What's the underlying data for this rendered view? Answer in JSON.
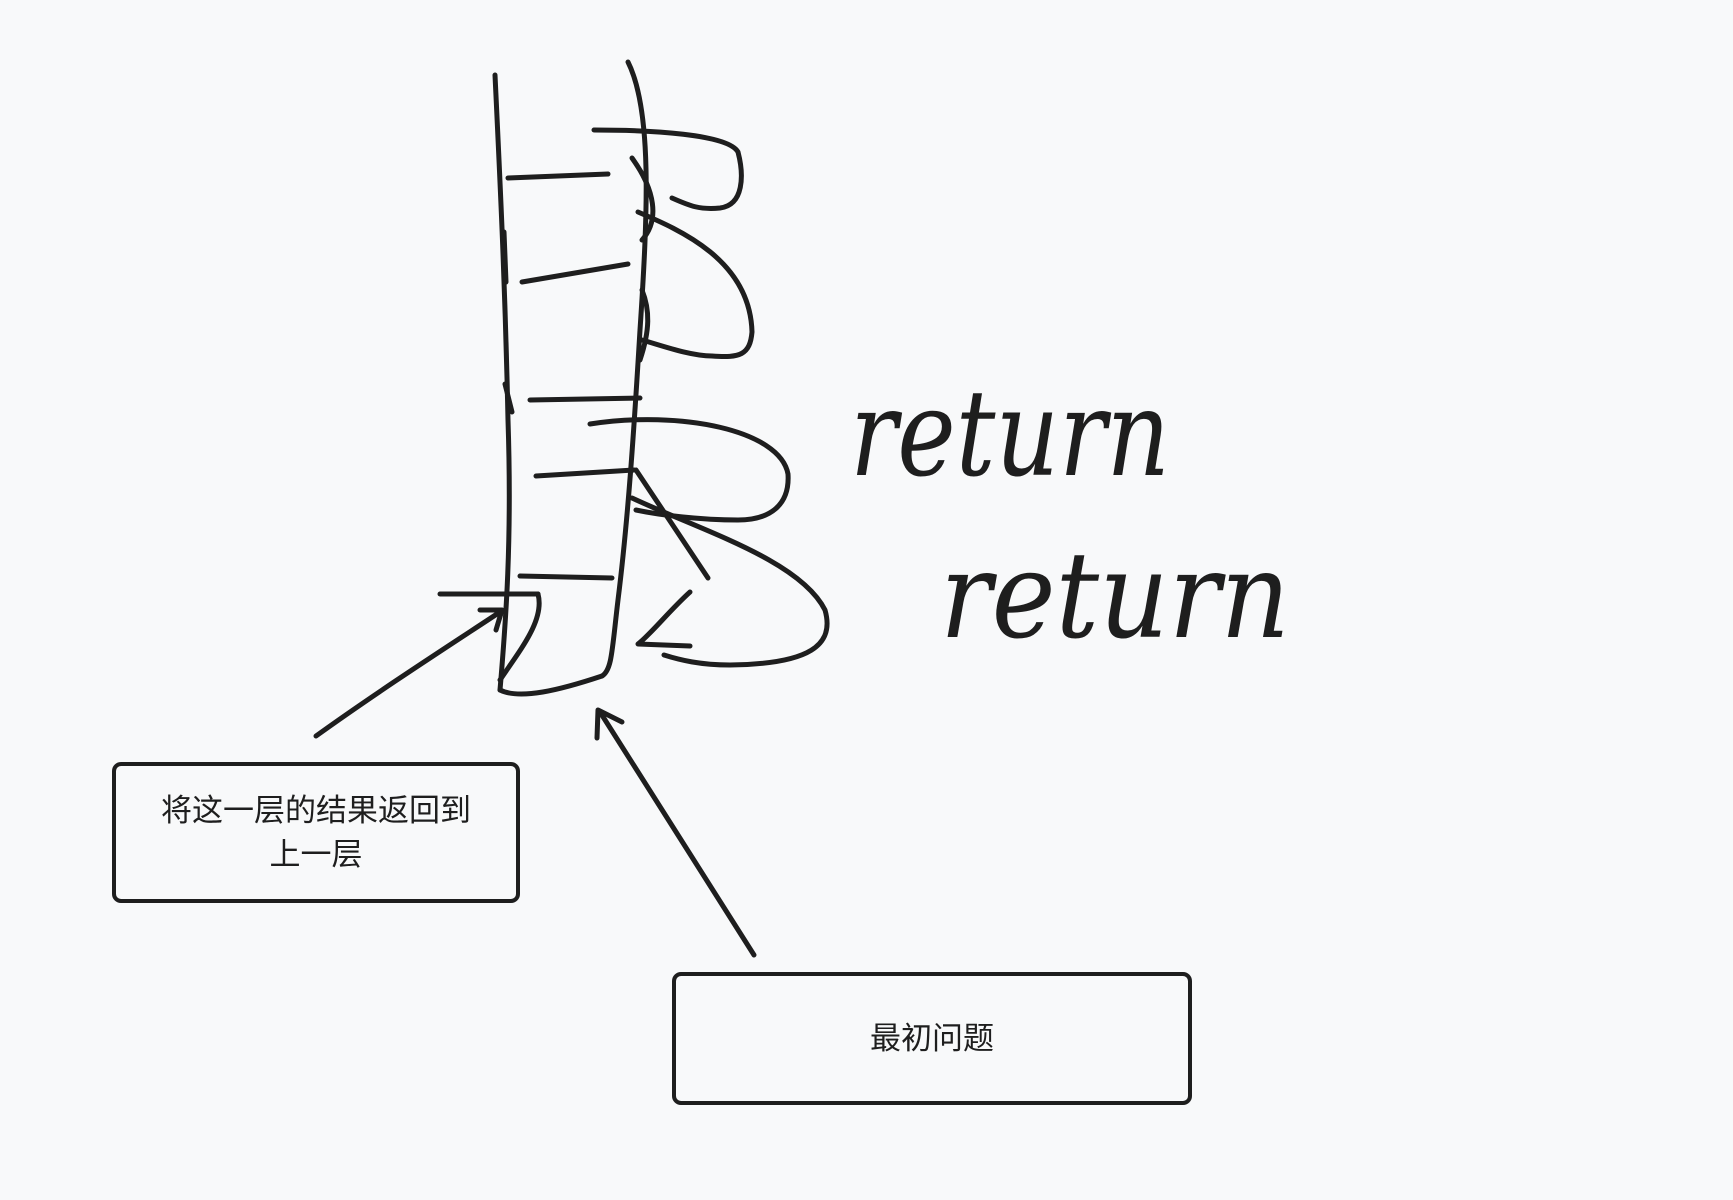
{
  "annotations": {
    "return_to_upper_layer": "将这一层的结果返回到上一层",
    "initial_problem": "最初问题"
  },
  "handwriting": {
    "line1": "return",
    "line2": "return"
  },
  "colors": {
    "background": "#f8f9fa",
    "stroke": "#1e1e1e"
  }
}
